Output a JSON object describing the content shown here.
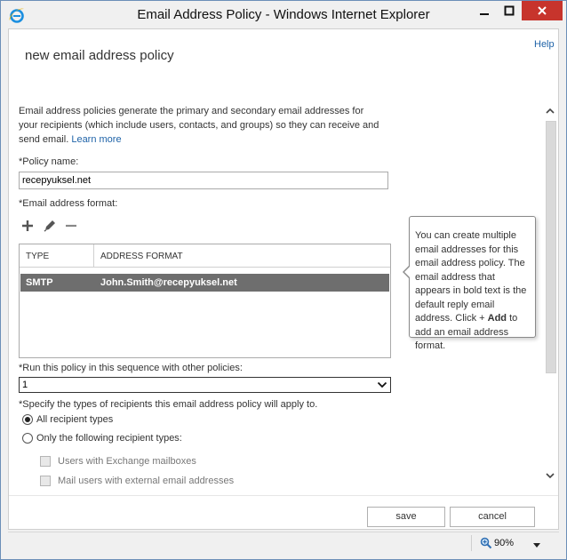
{
  "window": {
    "title": "Email Address Policy - Windows Internet Explorer"
  },
  "page": {
    "help_link": "Help",
    "title": "new email address policy",
    "description": "Email address policies generate the primary and secondary email addresses for your recipients (which include users, contacts, and groups) so they can receive and send email.",
    "learn_more": "Learn more"
  },
  "form": {
    "policy_name_label": "*Policy name:",
    "policy_name_value": "recepyuksel.net",
    "email_format_label": "*Email address format:",
    "grid": {
      "columns": [
        "TYPE",
        "ADDRESS FORMAT"
      ],
      "rows": [
        {
          "type": "SMTP",
          "format": "John.Smith@recepyuksel.net",
          "selected": true
        }
      ]
    },
    "callout": {
      "text_before": "You can create multiple email addresses for this email address policy. The email address that appears in bold text is the default reply email address. Click + ",
      "bold": "Add",
      "text_after": " to add an email address format."
    },
    "sequence_label": "*Run this policy in this sequence with other policies:",
    "sequence_value": "1",
    "recipients_label": "*Specify the types of recipients this email address policy will apply to.",
    "radio_all": "All recipient types",
    "radio_only": "Only the following recipient types:",
    "check_mailboxes": "Users with Exchange mailboxes",
    "check_mail_users": "Mail users with external email addresses"
  },
  "buttons": {
    "save": "save",
    "cancel": "cancel"
  },
  "status": {
    "zoom": "90%"
  },
  "colors": {
    "accent_link": "#1f63a8",
    "selected_row": "#6e6e6e",
    "close_button": "#c7342c"
  }
}
